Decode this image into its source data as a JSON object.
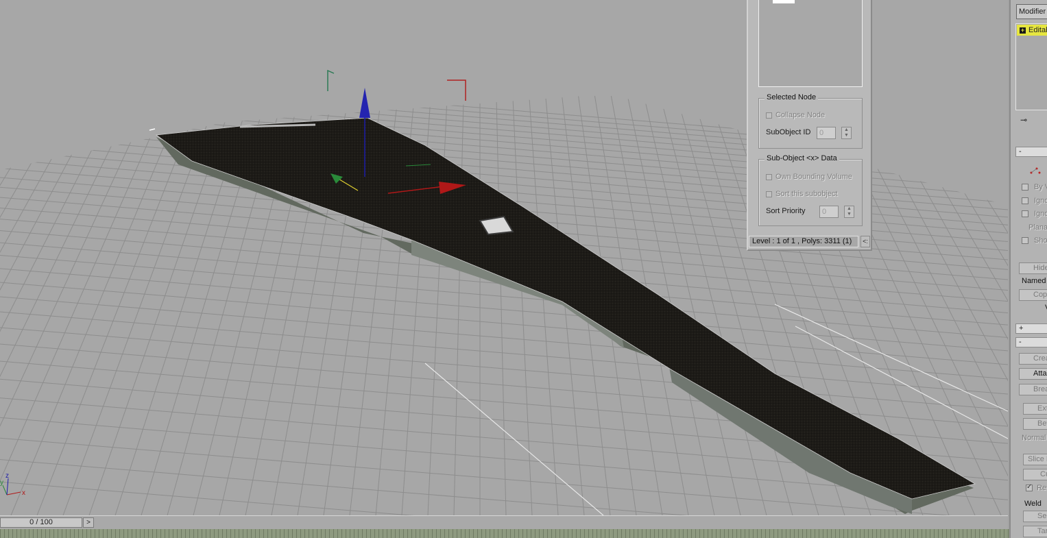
{
  "timeline": {
    "frame": "0 / 100",
    "next_arrow": ">"
  },
  "dialog": {
    "selected_node": {
      "title": "Selected Node",
      "collapse_node": "Collapse Node",
      "subobject_id_label": "SubObject ID",
      "subobject_id_value": "0"
    },
    "subobject_data": {
      "title": "Sub-Object <x> Data",
      "own_bounding_volume": "Own Bounding Volume",
      "sort_this_subobject": "Sort this subobject",
      "sort_priority_label": "Sort Priority",
      "sort_priority_value": "0"
    },
    "status": "Level : 1 of 1 , Polys: 3311 (1)",
    "collapse_arrow": "<:"
  },
  "command_panel": {
    "modifier_list": "Modifier List",
    "stack_item": "Editable Poly",
    "stack_item_expander": "+",
    "rollout1_toggle": "-",
    "rollout2_toggle": "+",
    "rollout3_toggle": "-",
    "by_vertex": "By Vertex",
    "ignore_backfacing": "Ignore Backfacing",
    "ignore_visible": "Ignore Visible",
    "planar_thresh": "Planar Thresh",
    "show_normals": "Show Normals",
    "hide": "Hide",
    "named_selections": "Named Selections:",
    "copy": "Copy",
    "v_label": "V",
    "create": "Create",
    "attach": "Attach",
    "break": "Break",
    "extrude": "Extrude",
    "bevel": "Bevel",
    "normal": "Normal",
    "slice_plane": "Slice Plane",
    "cut": "Cut",
    "reset_plane": "Reset Plane",
    "weld": "Weld",
    "select": "Select",
    "target": "Target"
  },
  "axis_labels": {
    "x": "x",
    "y": "y",
    "z": "z"
  },
  "colors": {
    "viewport_bg": "#a7a7a7",
    "grid_line": "#8c8c8c",
    "mesh_top": "#1e1c18",
    "mesh_side": "#6f7670",
    "stack_highlight": "#e6e640"
  }
}
